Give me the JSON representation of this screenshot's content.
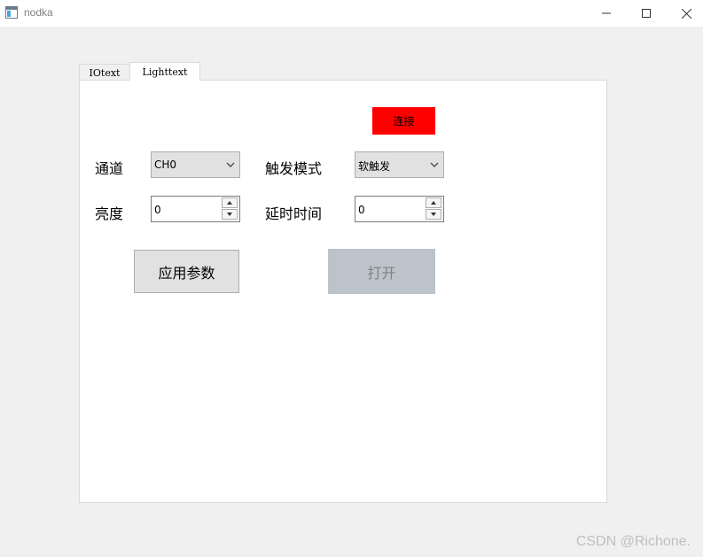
{
  "window": {
    "title": "nodka",
    "icons": {
      "app": "app-window-icon",
      "minimize": "minimize-icon",
      "maximize": "maximize-icon",
      "close": "close-icon"
    }
  },
  "tabs": [
    {
      "label": "IOtext",
      "active": false
    },
    {
      "label": "Lighttext",
      "active": true
    }
  ],
  "light": {
    "connect_label": "连接",
    "connect_color": "#ff0000",
    "channel": {
      "label": "通道",
      "value": "CH0"
    },
    "trigger": {
      "label": "触发模式",
      "value": "软触发"
    },
    "brightness": {
      "label": "亮度",
      "value": "0"
    },
    "delay": {
      "label": "延时时间",
      "value": "0"
    },
    "apply_label": "应用参数",
    "open_label": "打开"
  },
  "watermark": "CSDN @Richone."
}
